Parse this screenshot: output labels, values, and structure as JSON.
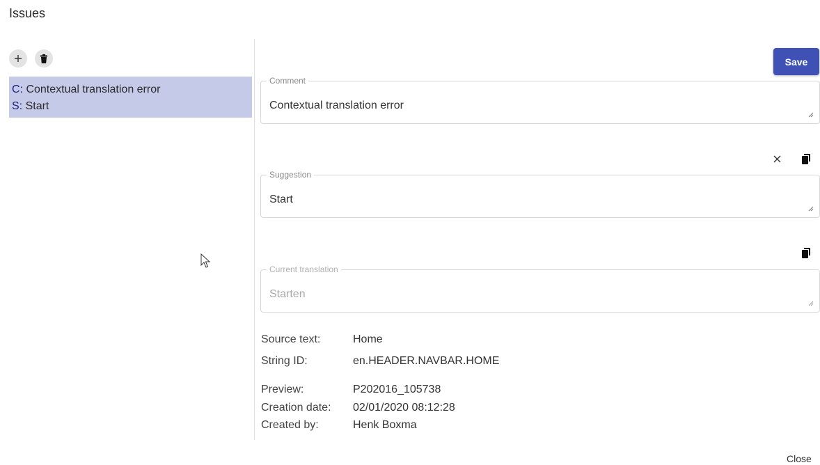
{
  "title": "Issues",
  "toolbar": {
    "add_icon": "plus-icon",
    "delete_icon": "trash-icon"
  },
  "issues": [
    {
      "comment_prefix": "C:",
      "comment": "Contextual translation error",
      "suggestion_prefix": "S:",
      "suggestion": "Start"
    }
  ],
  "save_label": "Save",
  "comment": {
    "label": "Comment",
    "value": "Contextual translation error"
  },
  "suggestion": {
    "label": "Suggestion",
    "value": "Start"
  },
  "current_translation": {
    "label": "Current translation",
    "value": "Starten"
  },
  "details": {
    "source_text_label": "Source text:",
    "source_text": "Home",
    "string_id_label": "String ID:",
    "string_id": "en.HEADER.NAVBAR.HOME",
    "preview_label": "Preview:",
    "preview": "P202016_105738",
    "creation_date_label": "Creation date:",
    "creation_date": "02/01/2020 08:12:28",
    "created_by_label": "Created by:",
    "created_by": "Henk Boxma"
  },
  "close_label": "Close",
  "colors": {
    "accent": "#3f51b5",
    "selected_row": "#c5cae9"
  }
}
